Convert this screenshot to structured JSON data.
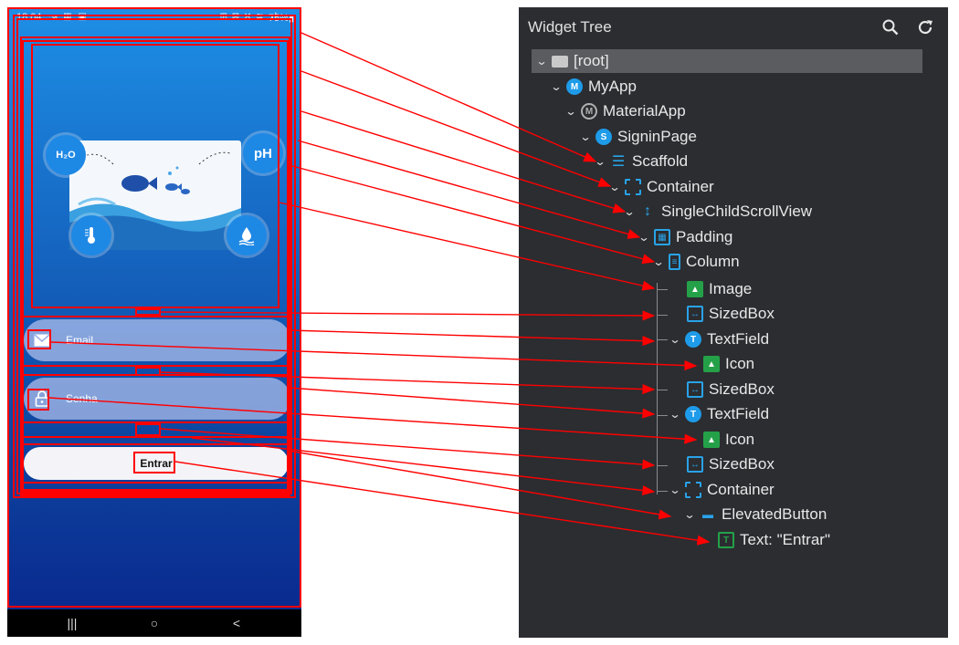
{
  "phone": {
    "status_bar": {
      "time": "18:04",
      "left_icons": "↝ ▦ ▣",
      "right_icons": "⊞ ⊠ ✕ ≋ .ıl",
      "battery": "75%▮"
    },
    "hero_icons": {
      "water": "H₂O",
      "ph": "pH",
      "temperature": "thermometer-icon",
      "water_level": "drop-icon"
    },
    "email_field": {
      "placeholder": "Email",
      "icon": "mail-icon"
    },
    "password_field": {
      "placeholder": "Senha",
      "icon": "lock-icon"
    },
    "login_button": {
      "label": "Entrar"
    },
    "nav_bar": {
      "recents": "|||",
      "home": "○",
      "back": "<"
    }
  },
  "widget_tree": {
    "title": "Widget Tree",
    "header_icons": [
      "search-icon",
      "refresh-icon"
    ],
    "nodes": [
      {
        "label": "[root]",
        "icon": "folder"
      },
      {
        "label": "MyApp",
        "icon": "M"
      },
      {
        "label": "MaterialApp",
        "icon": "material"
      },
      {
        "label": "SigninPage",
        "icon": "S"
      },
      {
        "label": "Scaffold",
        "icon": "scaffold"
      },
      {
        "label": "Container",
        "icon": "container"
      },
      {
        "label": "SingleChildScrollView",
        "icon": "scroll"
      },
      {
        "label": "Padding",
        "icon": "padding"
      },
      {
        "label": "Column",
        "icon": "column"
      },
      {
        "label": "Image",
        "icon": "image"
      },
      {
        "label": "SizedBox",
        "icon": "sizedbox"
      },
      {
        "label": "TextField",
        "icon": "T"
      },
      {
        "label": "Icon",
        "icon": "image"
      },
      {
        "label": "SizedBox",
        "icon": "sizedbox"
      },
      {
        "label": "TextField",
        "icon": "T"
      },
      {
        "label": "Icon",
        "icon": "image"
      },
      {
        "label": "SizedBox",
        "icon": "sizedbox"
      },
      {
        "label": "Container",
        "icon": "container"
      },
      {
        "label": "ElevatedButton",
        "icon": "button"
      },
      {
        "label": "Text: \"Entrar\"",
        "icon": "text"
      }
    ]
  },
  "colors": {
    "annotation": "#ff0000",
    "panel_bg": "#2b2d31",
    "accent_blue": "#1e9be9",
    "accent_green": "#24a148",
    "phone_gradient_top": "#1e8fe6",
    "phone_gradient_bottom": "#0a2a8f"
  }
}
